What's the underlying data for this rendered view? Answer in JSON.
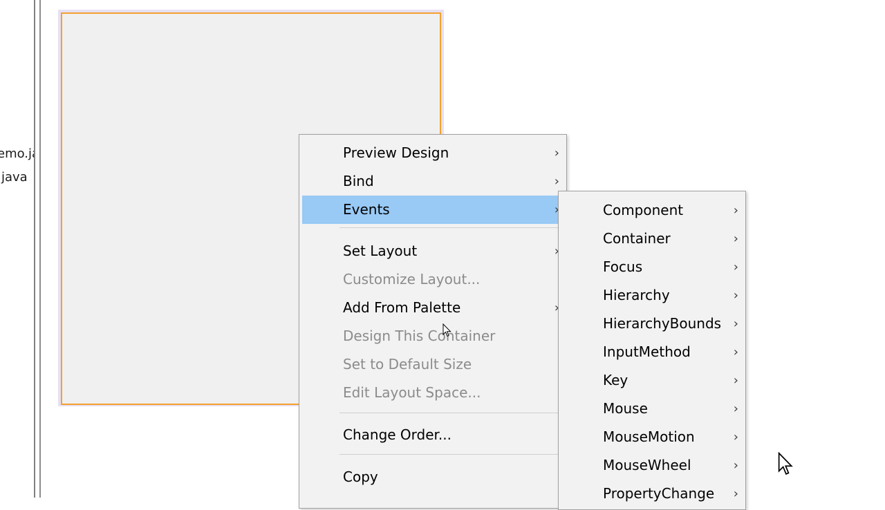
{
  "project_files": [
    "emo.ja",
    "java"
  ],
  "context_menu": {
    "items": [
      {
        "label": "Preview Design",
        "submenu": true,
        "disabled": false
      },
      {
        "label": "Bind",
        "submenu": true,
        "disabled": false
      },
      {
        "label": "Events",
        "submenu": true,
        "disabled": false,
        "highlighted": true
      },
      {
        "label": "Set Layout",
        "submenu": true,
        "disabled": false
      },
      {
        "label": "Customize Layout...",
        "submenu": false,
        "disabled": true
      },
      {
        "label": "Add From Palette",
        "submenu": true,
        "disabled": false
      },
      {
        "label": "Design This Container",
        "submenu": false,
        "disabled": true
      },
      {
        "label": "Set to Default Size",
        "submenu": false,
        "disabled": true
      },
      {
        "label": "Edit Layout Space...",
        "submenu": false,
        "disabled": true
      },
      {
        "label": "Change Order...",
        "submenu": false,
        "disabled": false
      },
      {
        "label": "Copy",
        "submenu": false,
        "disabled": false
      }
    ]
  },
  "events_submenu": {
    "items": [
      "Component",
      "Container",
      "Focus",
      "Hierarchy",
      "HierarchyBounds",
      "InputMethod",
      "Key",
      "Mouse",
      "MouseMotion",
      "MouseWheel",
      "PropertyChange"
    ]
  },
  "colors": {
    "highlight": "#99c9f5",
    "frame_border": "#f5a02d",
    "menu_bg": "#f2f2f2",
    "disabled_text": "#8b8b8b"
  },
  "icons": {
    "submenu_arrow": "chevron-right-icon",
    "cursor": "mouse-pointer-icon"
  }
}
